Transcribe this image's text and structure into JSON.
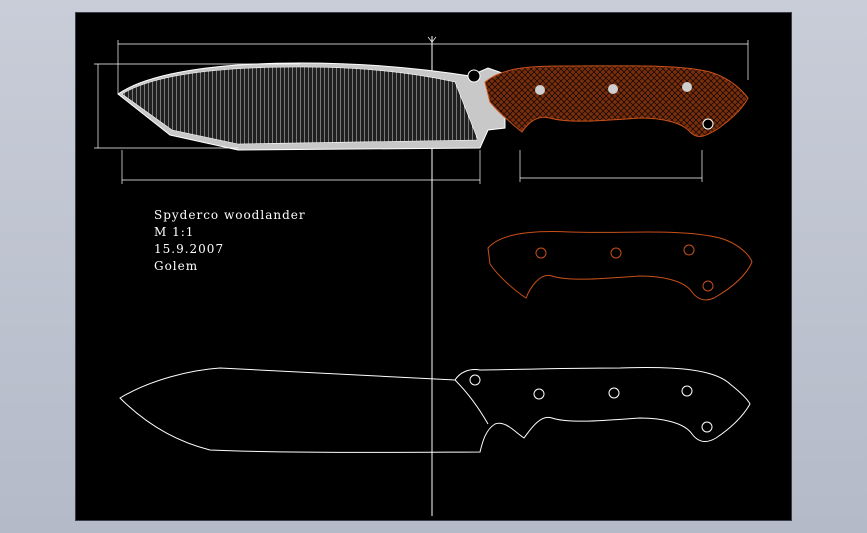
{
  "title_block": {
    "line1": "Spyderco woodlander",
    "line2": "M 1:1",
    "line3": "15.9.2007",
    "line4": "Golem"
  },
  "colors": {
    "background": "#000000",
    "outline": "#ffffff",
    "blade_fill": "#c8c8c8",
    "handle_scale": "#9a3c10",
    "handle_outline": "#c8501a",
    "dimension": "#ffffff"
  },
  "dimensions": {
    "overall_length": "",
    "blade_length": "",
    "handle_length": ""
  }
}
